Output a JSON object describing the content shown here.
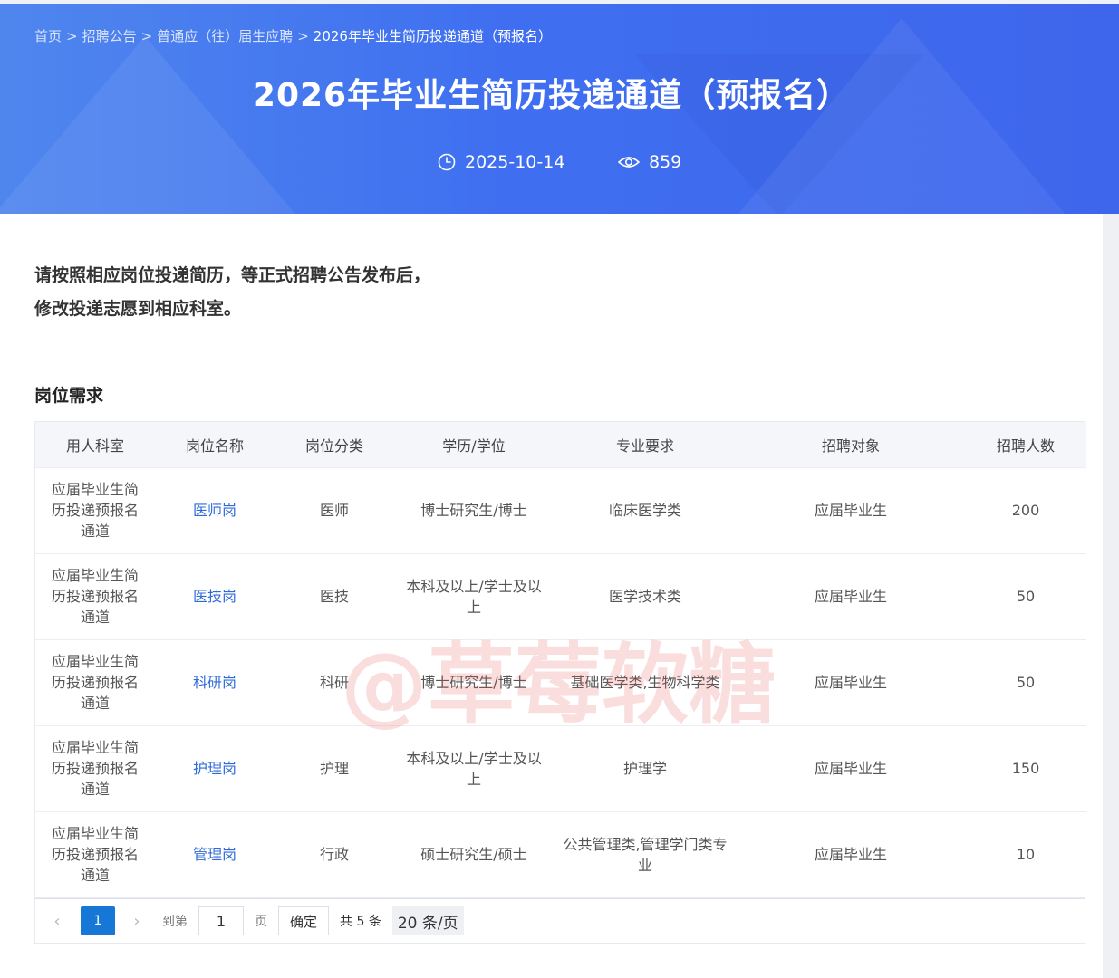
{
  "breadcrumb": {
    "items": [
      "首页",
      "招聘公告",
      "普通应（往）届生应聘"
    ],
    "current": "2026年毕业生简历投递通道（预报名）",
    "separator": ">"
  },
  "page": {
    "title": "2026年毕业生简历投递通道（预报名）",
    "date": "2025-10-14",
    "views": "859"
  },
  "intro": {
    "line1": "请按照相应岗位投递简历，等正式招聘公告发布后，",
    "line2": "修改投递志愿到相应科室。"
  },
  "section": {
    "title": "岗位需求"
  },
  "table": {
    "headers": [
      "用人科室",
      "岗位名称",
      "岗位分类",
      "学历/学位",
      "专业要求",
      "招聘对象",
      "招聘人数"
    ],
    "rows": [
      {
        "dept": "应届毕业生简历投递预报名通道",
        "position": "医师岗",
        "category": "医师",
        "degree": "博士研究生/博士",
        "major": "临床医学类",
        "target": "应届毕业生",
        "count": "200"
      },
      {
        "dept": "应届毕业生简历投递预报名通道",
        "position": "医技岗",
        "category": "医技",
        "degree": "本科及以上/学士及以上",
        "major": "医学技术类",
        "target": "应届毕业生",
        "count": "50"
      },
      {
        "dept": "应届毕业生简历投递预报名通道",
        "position": "科研岗",
        "category": "科研",
        "degree": "博士研究生/博士",
        "major": "基础医学类,生物科学类",
        "target": "应届毕业生",
        "count": "50"
      },
      {
        "dept": "应届毕业生简历投递预报名通道",
        "position": "护理岗",
        "category": "护理",
        "degree": "本科及以上/学士及以上",
        "major": "护理学",
        "target": "应届毕业生",
        "count": "150"
      },
      {
        "dept": "应届毕业生简历投递预报名通道",
        "position": "管理岗",
        "category": "行政",
        "degree": "硕士研究生/硕士",
        "major": "公共管理类,管理学门类专业",
        "target": "应届毕业生",
        "count": "10"
      }
    ]
  },
  "pagination": {
    "current_page": "1",
    "goto_label": "到第",
    "goto_value": "1",
    "page_unit": "页",
    "confirm_label": "确定",
    "total_label": "共 5 条",
    "page_size": "20 条/页"
  },
  "watermark": {
    "main": "@草莓软糖"
  },
  "colors": {
    "banner": "#3f6ff0",
    "link": "#2f6bd8",
    "pager_active": "#1677d6"
  }
}
